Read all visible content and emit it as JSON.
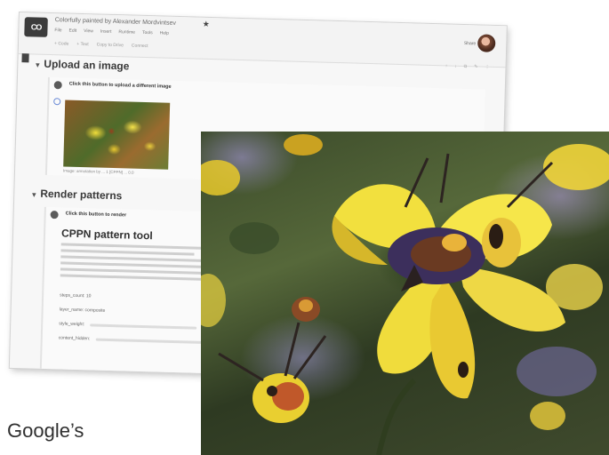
{
  "colab": {
    "logo_text": "CO",
    "doc_title": "Colorfully painted by Alexander Mordvintsev",
    "menu": [
      "File",
      "Edit",
      "View",
      "Insert",
      "Runtime",
      "Tools",
      "Help"
    ],
    "toolbar": [
      "+ Code",
      "+ Text",
      "Copy to Drive",
      "Connect"
    ],
    "share_label": "Share",
    "section_upload_title": "Upload an image",
    "upload_cell_heading": "Click this button to upload a different image",
    "thumb_caption": "Image: annotation by ... 1 [CPPN] ... 0.0",
    "section_render_title": "Render patterns",
    "render_cell_heading": "Click this button to render",
    "cppn_title": "CPPN pattern tool",
    "params": [
      {
        "label": "steps_count: 10"
      },
      {
        "label": "layer_name: composite"
      },
      {
        "label": "style_weight:"
      },
      {
        "label": "content_hidden:"
      }
    ]
  },
  "caption": "Google’s"
}
